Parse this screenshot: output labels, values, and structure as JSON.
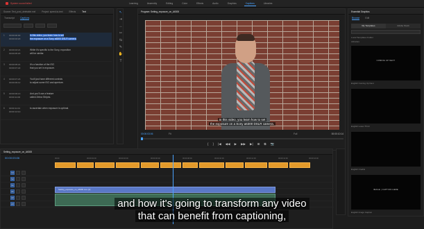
{
  "topbar": {
    "status": "System sound failed",
    "workspaces": [
      "Learning",
      "Assembly",
      "Editing",
      "Color",
      "Effects",
      "Audio",
      "Graphics",
      "Captions",
      "Libraries"
    ],
    "active_workspace": "Captions"
  },
  "text_panel": {
    "tabs": [
      "Source: Text_post_deletable.mxf",
      "Project: speed-to-text",
      "Effects",
      "Text"
    ],
    "active_tab": "Text",
    "subtabs": [
      "Transcript",
      "Captions"
    ],
    "active_subtab": "Captions",
    "captions": [
      {
        "num": "1",
        "tc": "00:00:00:00\n00:00:03:20",
        "text": "In this video, you learn how to set\nthe exposure on a Sony a6300 DSLR camera."
      },
      {
        "num": "2",
        "tc": "00:00:03:21\n00:00:05:20",
        "text": "While it's specific to the Sony, exposition\nwill be similar."
      },
      {
        "num": "3",
        "tc": "00:00:05:21\n00:00:07:22",
        "text": "It's a function of the ISO\nthat you set in exposure."
      },
      {
        "num": "4",
        "tc": "00:00:07:23\n00:00:09:12",
        "text": "You'll just have different controls\nto adjust some ISO and aperture."
      },
      {
        "num": "5",
        "tc": "00:00:09:13\n00:00:11:00",
        "text": "And you'll use a feature\ncalled Zebra Stripes."
      },
      {
        "num": "6",
        "tc": "00:00:11:01\n00:00:13:10",
        "text": "to ascertain when exposure is optimal."
      }
    ]
  },
  "program": {
    "tab": "Program: Setting_exposure_on_A6300",
    "video_caption_line1": "In this video, you learn how to set",
    "video_caption_line2": "the exposure on a Sony a6300 DSLR camera.",
    "timecode_left": "00:00:03:06",
    "fit": "Fit",
    "full": "Full",
    "timecode_right": "00:00:10:14",
    "transport": [
      "{",
      "}",
      "|◀",
      "◀◀",
      "▶",
      "▶▶",
      "▶|",
      "⊞",
      "⧉",
      "📷"
    ]
  },
  "essential_graphics": {
    "title": "Essential Graphics",
    "browse": "Browse",
    "edit": "Edit",
    "seg": [
      "My Templates",
      "Adobe Stock"
    ],
    "local_templates": "Local Templates Folder",
    "libraries": "Libraries",
    "thumbs": [
      {
        "inner": "COMING UP NEXT",
        "label": "English Coming Up Next"
      },
      {
        "inner": "",
        "label": "English Lower Third"
      },
      {
        "inner": "",
        "label": "English Credits"
      },
      {
        "inner": "IMAGE | CAPTION HERE",
        "label": "English Image Caption"
      },
      {
        "inner": "",
        "label": ""
      }
    ]
  },
  "timeline": {
    "tab": "Setting_exposure_on_A6300",
    "timecode": "00:00:03:06",
    "ruler": [
      "00:00",
      "00:00:02:00",
      "00:00:04:00",
      "00:00:06:00",
      "00:00:08:00",
      "00:00:10:00",
      "00:00:12:00",
      "00:00:14:00",
      "00:00:16:00"
    ],
    "tracks": [
      "C1",
      "V3",
      "V2",
      "V1",
      "A1",
      "A2",
      "A3"
    ],
    "video_clip_label": "Setting_exposure_on_A6300.mov [V]"
  },
  "big_caption": {
    "line1": "and how it's going to transform any video",
    "line2": "that can benefit from captioning,"
  }
}
